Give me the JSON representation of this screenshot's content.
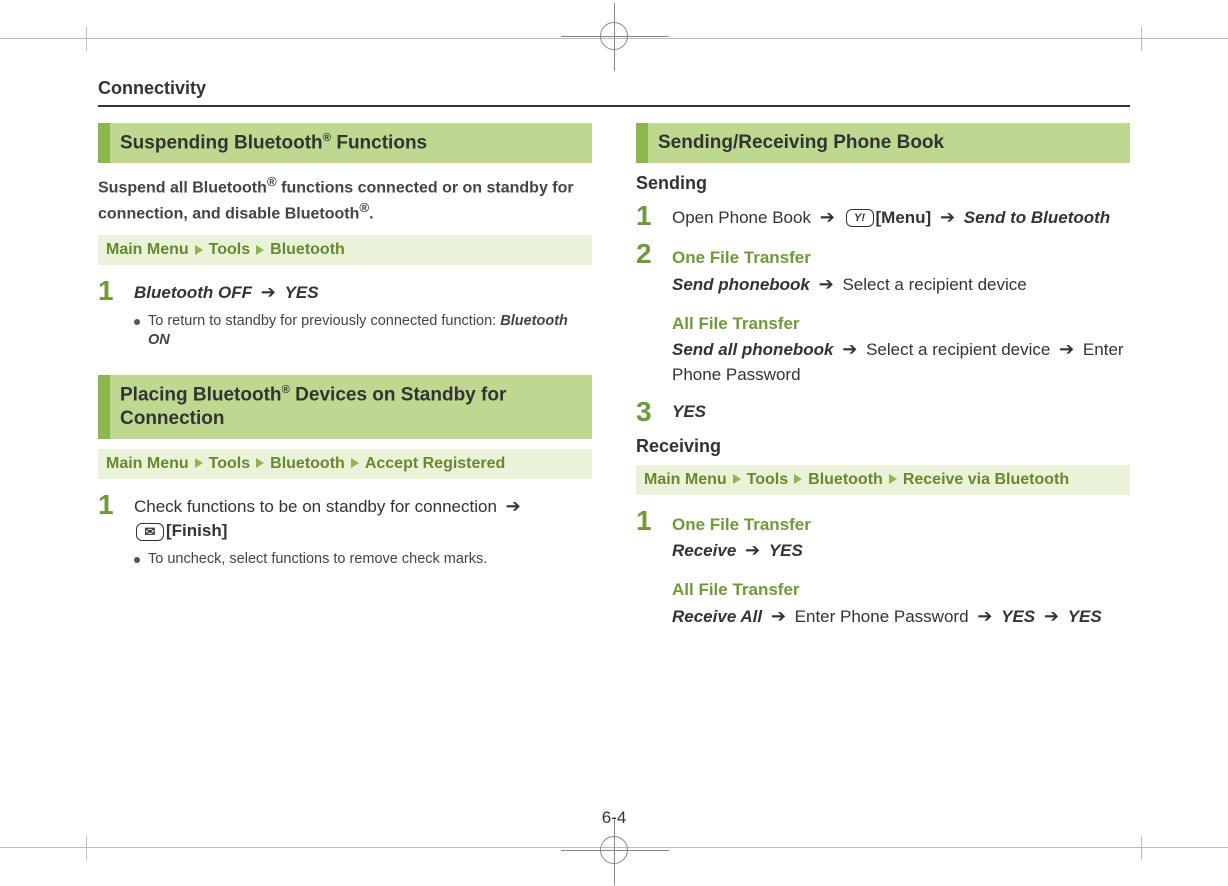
{
  "chapter": "Connectivity",
  "pageNumber": "6-4",
  "left": {
    "section1": {
      "title_pre": "Suspending Bluetooth",
      "title_post": " Functions",
      "intro_pre": "Suspend all Bluetooth",
      "intro_post": " functions connected or on standby for connection, and disable Bluetooth",
      "menu": {
        "a": "Main Menu",
        "b": "Tools",
        "c": "Bluetooth"
      },
      "step1": {
        "off": "Bluetooth OFF",
        "yes": "YES",
        "bullet_pre": "To return to standby for previously connected function: ",
        "bullet_bold": "Bluetooth ON"
      }
    },
    "section2": {
      "title_pre": "Placing Bluetooth",
      "title_post": " Devices on Standby for Connection",
      "menu": {
        "a": "Main Menu",
        "b": "Tools",
        "c": "Bluetooth",
        "d": "Accept Registered"
      },
      "step1": {
        "text": "Check functions to be on standby for connection",
        "finish": "[Finish]",
        "bullet": "To uncheck, select functions to remove check marks."
      }
    }
  },
  "right": {
    "section1": {
      "title": "Sending/Receiving Phone Book",
      "sending": "Sending",
      "step1": {
        "open": "Open Phone Book",
        "menu": "[Menu]",
        "send": "Send to Bluetooth"
      },
      "step2": {
        "one": "One File Transfer",
        "sendpb": "Send phonebook",
        "select1": "Select a recipient device",
        "all": "All File Transfer",
        "sendall": "Send all phonebook",
        "select2": "Select a recipient device",
        "enter": "Enter Phone Password"
      },
      "step3": {
        "yes": "YES"
      },
      "receiving": "Receiving",
      "menu": {
        "a": "Main Menu",
        "b": "Tools",
        "c": "Bluetooth",
        "d": "Receive via Bluetooth"
      },
      "rstep1": {
        "one": "One File Transfer",
        "receive": "Receive",
        "yes1": "YES",
        "all": "All File Transfer",
        "recvall": "Receive All",
        "enter": "Enter Phone Password",
        "yes2": "YES",
        "yes3": "YES"
      }
    }
  }
}
